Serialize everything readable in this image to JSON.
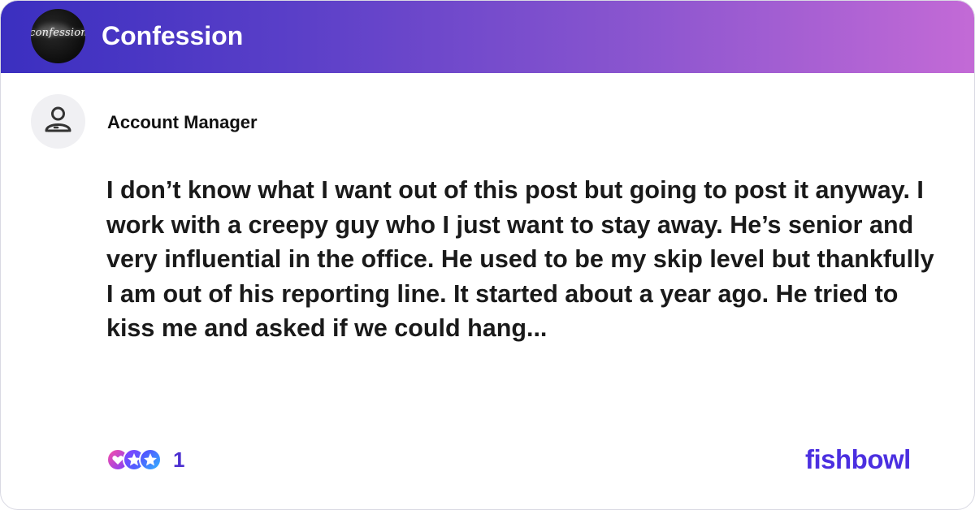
{
  "header": {
    "logo_text": "confession",
    "title": "Confession",
    "colors": {
      "gradient_start": "#3b2fc0",
      "gradient_end": "#c36ad6"
    }
  },
  "post": {
    "author": "Account Manager",
    "avatar_icon": "user-outline-icon",
    "text": "I don’t know what I want out of this post  but going to post it anyway. I work with a creepy guy who I just want to stay away. He’s senior and very influential in the office. He used to be my skip level but thankfully I am out of his reporting line. It started about a year ago. He tried to kiss me and asked if we could hang..."
  },
  "footer": {
    "reaction_icons": [
      "heart-icon",
      "star-icon",
      "star-icon"
    ],
    "reaction_count": "1",
    "brand": "fishbowl",
    "brand_color": "#4b2fe0"
  }
}
